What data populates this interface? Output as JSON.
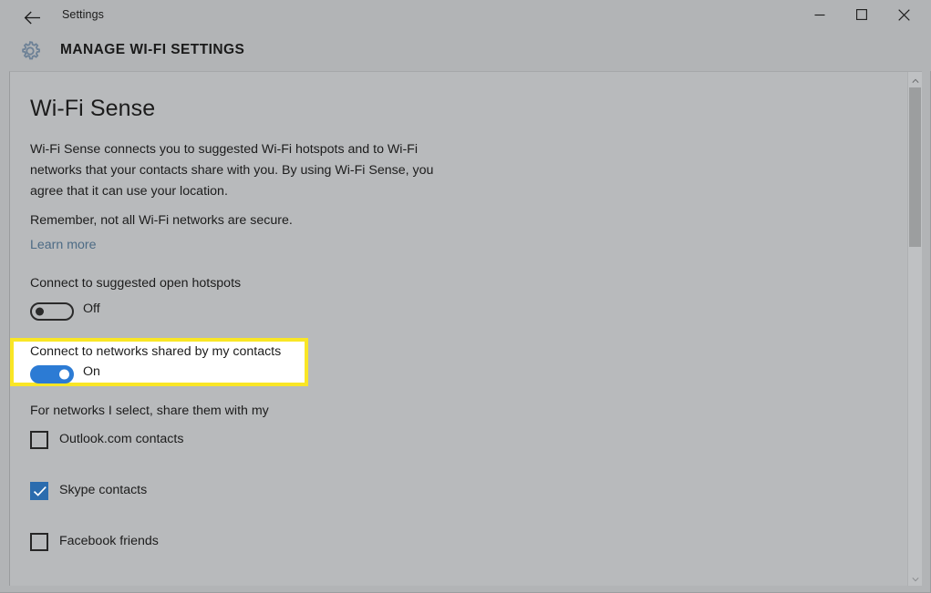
{
  "window": {
    "app_title": "Settings",
    "back_icon": "back-arrow-icon",
    "minimize_label": "Minimize",
    "maximize_label": "Maximize",
    "close_label": "Close"
  },
  "header": {
    "icon": "gear-icon",
    "title": "MANAGE WI-FI SETTINGS"
  },
  "content": {
    "heading": "Wi-Fi Sense",
    "paragraph_1": "Wi-Fi Sense connects you to suggested Wi-Fi hotspots and to Wi-Fi networks that your contacts share with you. By using Wi-Fi Sense, you agree that it can use your location.",
    "paragraph_2": "Remember, not all Wi-Fi networks are secure.",
    "learn_more": "Learn more",
    "settings": [
      {
        "label": "Connect to suggested open hotspots",
        "state": "Off",
        "on": false,
        "highlighted": false
      },
      {
        "label": "Connect to networks shared by my contacts",
        "state": "On",
        "on": true,
        "highlighted": true
      }
    ],
    "share_heading": "For networks I select, share them with my",
    "checkboxes": [
      {
        "label": "Outlook.com contacts",
        "checked": false
      },
      {
        "label": "Skype contacts",
        "checked": true
      },
      {
        "label": "Facebook friends",
        "checked": false
      }
    ]
  },
  "scrollbar": {
    "up_icon": "chevron-up-icon",
    "down_icon": "chevron-down-icon"
  },
  "colors": {
    "accent_blue": "#2c7bd4",
    "checkbox_blue": "#2b6cae",
    "highlight_yellow": "#f9e625",
    "link_blue": "#4d6b85",
    "window_chrome": "#b2b4b6",
    "content_bg": "#b8babc"
  }
}
